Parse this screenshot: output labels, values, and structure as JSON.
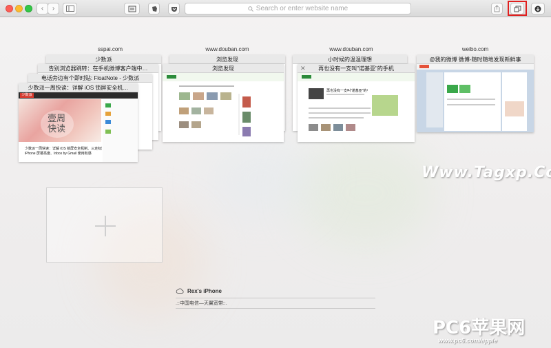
{
  "toolbar": {
    "url_placeholder": "Search or enter website name",
    "reader_icon": "reader-icon",
    "evernote_icon": "evernote-icon",
    "pocket_icon": "pocket-icon",
    "share_icon": "share-icon",
    "tabs_icon": "tab-overview-icon",
    "download_icon": "download-icon",
    "highlight_color": "#e0201f"
  },
  "groups": [
    {
      "site": "sspai.com",
      "tabs": [
        "少数派",
        "告别浏览器跳转：在手机微博客户端中…",
        "电话旁边有个即时贴: FloatNote - 少数派",
        "少数派一周快读：详解 iOS 锁屏安全机…"
      ]
    },
    {
      "site": "www.douban.com",
      "tabs": [
        "浏览发现",
        "浏览发现"
      ]
    },
    {
      "site": "www.douban.com",
      "tabs": [
        "小时候的温温理想",
        "再也没有一支叫\"诺基亚\"的手机"
      ]
    },
    {
      "site": "weibo.com",
      "tabs": [
        "@我的微博 微博-随时随地发现新鲜事"
      ]
    }
  ],
  "previews": {
    "sspai_logo": "少数派",
    "sspai_badge_big": "壹周\n快读",
    "sspai_badge_line1": "壹周",
    "sspai_badge_line2": "快读",
    "sspai_caption": "少数派一周快读：详解 iOS 锁屏安全机制、三走标题应用",
    "sspai_caption2": "iPhone 屏幕亮度、Inbox by Gmail 使用有感",
    "nokia_headline": "再也没有一支叫\"诺基亚\"的手机"
  },
  "icloud": {
    "device": "Rex's iPhone",
    "tab": ".::中国电信—天翼宽带::."
  },
  "watermarks": {
    "tagxp": "Www.Tagxp.Com",
    "pc6": "PC6苹果网",
    "pc6_url": "www.pc6.com/apple"
  }
}
